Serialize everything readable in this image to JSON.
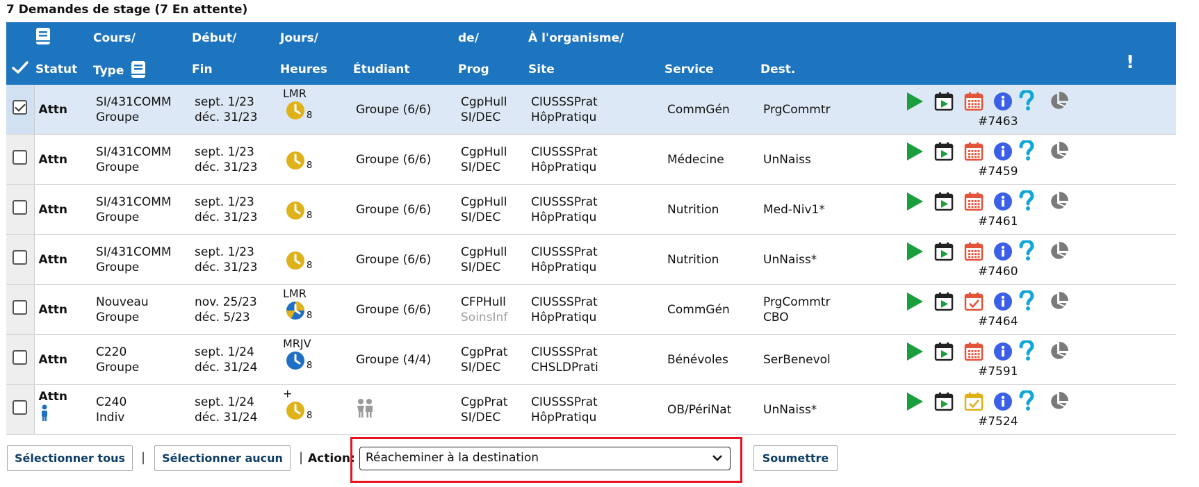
{
  "heading": "7 Demandes de stage (7 En attente)",
  "columns": {
    "statut": "Statut",
    "cours_top": "Cours/",
    "cours_bottom": "Type",
    "debut_top": "Début/",
    "debut_bottom": "Fin",
    "jours_top": "Jours/",
    "jours_bottom": "Heures",
    "etudiant": "Étudiant",
    "de_top": "de/",
    "de_bottom": "Prog",
    "org_top": "À l'organisme/",
    "org_bottom": "Site",
    "service": "Service",
    "dest": "Dest.",
    "alert": "!"
  },
  "rows": [
    {
      "checked": true,
      "statut": "Attn",
      "cours": "SI/431COMM",
      "type": "Groupe",
      "debut": "sept. 1/23",
      "fin": "déc. 31/23",
      "jours": "LMR",
      "clock": "yellow",
      "heures": "8",
      "etudiant": "Groupe (6/6)",
      "de": "CgpHull",
      "prog": "SI/DEC",
      "org": "CIUSSSPrat",
      "site": "HôpPratiqu",
      "service": "CommGén",
      "dest": "PrgCommtr",
      "dest2": "",
      "ticket": "#7463",
      "cal": "red"
    },
    {
      "checked": false,
      "statut": "Attn",
      "cours": "SI/431COMM",
      "type": "Groupe",
      "debut": "sept. 1/23",
      "fin": "déc. 31/23",
      "jours": "",
      "clock": "yellow",
      "heures": "8",
      "etudiant": "Groupe (6/6)",
      "de": "CgpHull",
      "prog": "SI/DEC",
      "org": "CIUSSSPrat",
      "site": "HôpPratiqu",
      "service": "Médecine",
      "dest": "UnNaiss",
      "dest2": "",
      "ticket": "#7459",
      "cal": "red"
    },
    {
      "checked": false,
      "statut": "Attn",
      "cours": "SI/431COMM",
      "type": "Groupe",
      "debut": "sept. 1/23",
      "fin": "déc. 31/23",
      "jours": "",
      "clock": "yellow",
      "heures": "8",
      "etudiant": "Groupe (6/6)",
      "de": "CgpHull",
      "prog": "SI/DEC",
      "org": "CIUSSSPrat",
      "site": "HôpPratiqu",
      "service": "Nutrition",
      "dest": "Med-Niv1*",
      "dest2": "",
      "ticket": "#7461",
      "cal": "red"
    },
    {
      "checked": false,
      "statut": "Attn",
      "cours": "SI/431COMM",
      "type": "Groupe",
      "debut": "sept. 1/23",
      "fin": "déc. 31/23",
      "jours": "",
      "clock": "yellow",
      "heures": "8",
      "etudiant": "Groupe (6/6)",
      "de": "CgpHull",
      "prog": "SI/DEC",
      "org": "CIUSSSPrat",
      "site": "HôpPratiqu",
      "service": "Nutrition",
      "dest": "UnNaiss*",
      "dest2": "",
      "ticket": "#7460",
      "cal": "red"
    },
    {
      "checked": false,
      "statut": "Attn",
      "cours": "Nouveau",
      "type": "Groupe",
      "debut": "nov. 25/23",
      "fin": "déc. 5/23",
      "jours": "LMR",
      "clock": "mixed",
      "heures": "8",
      "etudiant": "Groupe (6/6)",
      "de": "CFPHull",
      "prog": "SoinsInf",
      "prog_muted": true,
      "org": "CIUSSSPrat",
      "site": "HôpPratiqu",
      "service": "CommGén",
      "dest": "PrgCommtr",
      "dest2": "CBO",
      "ticket": "#7464",
      "cal": "red-check"
    },
    {
      "checked": false,
      "statut": "Attn",
      "cours": "C220",
      "type": "Groupe",
      "debut": "sept. 1/24",
      "fin": "déc. 31/24",
      "jours": "MRJV",
      "clock": "blue",
      "heures": "8",
      "etudiant": "Groupe (4/4)",
      "de": "CgpPrat",
      "prog": "SI/DEC",
      "org": "CIUSSSPrat",
      "site": "CHSLDPrati",
      "service": "Bénévoles",
      "dest": "SerBenevol",
      "dest2": "",
      "ticket": "#7591",
      "cal": "red"
    },
    {
      "checked": false,
      "statut": "Attn",
      "cours": "C240",
      "type": "Indiv",
      "debut": "sept. 1/24",
      "fin": "déc. 31/24",
      "jours": "+",
      "clock": "yellow",
      "heures": "8",
      "etudiant": "",
      "de": "CgpPrat",
      "prog": "SI/DEC",
      "org": "CIUSSSPrat",
      "site": "HôpPratiqu",
      "service": "OB/PériNat",
      "dest": "UnNaiss*",
      "dest2": "",
      "ticket": "#7524",
      "cal": "yellow-check"
    }
  ],
  "footer": {
    "select_all": "Sélectionner tous",
    "select_none": "Sélectionner aucun",
    "separator": "|",
    "action_label": "Action:",
    "action_value": "Réacheminer à la destination",
    "submit": "Soumettre"
  },
  "colors": {
    "header_bg": "#1d74bf",
    "selected_row": "#dce8f5",
    "play_green": "#1b9e3e",
    "info_blue": "#3b5fe6",
    "help_cyan": "#12a6d8",
    "pie_gray": "#7a7a7a",
    "cal_red": "#e3553a",
    "cal_yellow": "#e0b21a",
    "clock_yellow": "#e0b21a",
    "clock_blue": "#1f6fc4",
    "highlight_red": "#e8141f"
  }
}
